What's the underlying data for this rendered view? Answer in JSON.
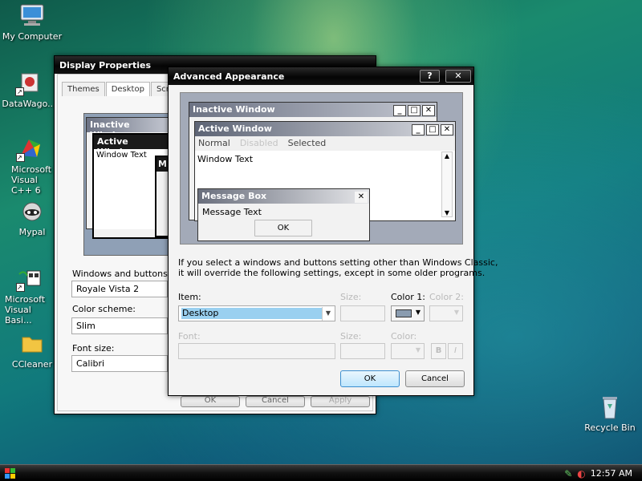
{
  "desktop": {
    "icons": [
      {
        "label": "My Computer",
        "icon": "computer-icon"
      },
      {
        "label": "DataWago...",
        "icon": "datawago-icon"
      },
      {
        "label": "Microsoft Visual C++ 6",
        "icon": "visual-cpp-icon"
      },
      {
        "label": "Mypal",
        "icon": "mypal-icon"
      },
      {
        "label": "Microsoft Visual Basi...",
        "icon": "visual-basic-icon"
      },
      {
        "label": "CCleaner",
        "icon": "folder-icon"
      },
      {
        "label": "Recycle Bin",
        "icon": "recycle-bin-icon"
      }
    ]
  },
  "taskbar": {
    "clock": "12:57 AM"
  },
  "display_properties": {
    "title": "Display Properties",
    "tabs": [
      "Themes",
      "Desktop",
      "Scree..."
    ],
    "preview": {
      "inactive_title": "Inactive Window",
      "active_title": "Active Window",
      "window_text": "Window Text",
      "partial_title": "M"
    },
    "windows_and_buttons_label": "Windows and buttons:",
    "windows_and_buttons_value": "Royale Vista 2",
    "color_scheme_label": "Color scheme:",
    "color_scheme_value": "Slim",
    "font_size_label": "Font size:",
    "font_size_value": "Calibri",
    "ok_label": "OK",
    "cancel_label": "Cancel",
    "apply_label": "Apply"
  },
  "advanced_appearance": {
    "title": "Advanced Appearance",
    "help_label": "?",
    "close_label": "✕",
    "preview": {
      "inactive_title": "Inactive Window",
      "active_title": "Active Window",
      "menu": [
        "Normal",
        "Disabled",
        "Selected"
      ],
      "window_text": "Window Text",
      "message_box_title": "Message Box",
      "message_text": "Message Text",
      "message_ok": "OK"
    },
    "info_text_line1": "If you select a windows and buttons setting other than Windows Classic,",
    "info_text_line2": "it will override the following settings, except in some older programs.",
    "item_label": "Item:",
    "item_value": "Desktop",
    "size_label": "Size:",
    "color1_label": "Color 1:",
    "color2_label": "Color 2:",
    "font_label": "Font:",
    "font_size_label": "Size:",
    "font_color_label": "Color:",
    "bold_label": "B",
    "italic_label": "I",
    "color1_swatch": "#8a9cb0",
    "ok_label": "OK",
    "cancel_label": "Cancel"
  }
}
